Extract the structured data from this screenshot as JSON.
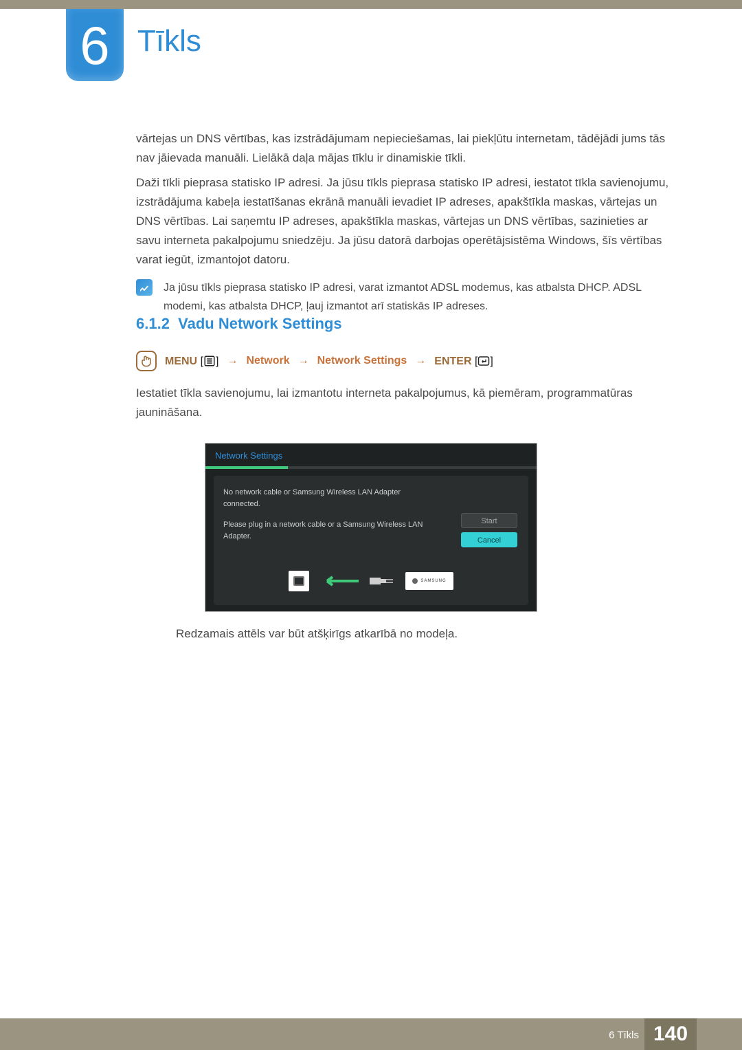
{
  "chapter": {
    "number": "6",
    "title": "Tīkls"
  },
  "para1": "vārtejas un DNS vērtības, kas izstrādājumam nepieciešamas, lai piekļūtu internetam, tādējādi jums tās nav jāievada manuāli. Lielākā daļa mājas tīklu ir dinamiskie tīkli.",
  "para2": "Daži tīkli pieprasa statisko IP adresi. Ja jūsu tīkls pieprasa statisko IP adresi, iestatot tīkla savienojumu, izstrādājuma kabeļa iestatīšanas ekrānā manuāli ievadiet IP adreses, apakštīkla maskas, vārtejas un DNS vērtības. Lai saņemtu IP adreses, apakštīkla maskas, vārtejas un DNS vērtības, sazinieties ar savu interneta pakalpojumu sniedzēju. Ja jūsu datorā darbojas operētājsistēma Windows, šīs vērtības varat iegūt, izmantojot datoru.",
  "note": "Ja jūsu tīkls pieprasa statisko IP adresi, varat izmantot ADSL modemus, kas atbalsta DHCP. ADSL modemi, kas atbalsta DHCP, ļauj izmantot arī statiskās IP adreses.",
  "section": {
    "number": "6.1.2",
    "title": "Vadu Network Settings"
  },
  "nav": {
    "menu": "MENU",
    "arrow": "→",
    "network": "Network",
    "network_settings": "Network Settings",
    "enter": "ENTER"
  },
  "body3": "Iestatiet tīkla savienojumu, lai izmantotu interneta pakalpojumus, kā piemēram, programmatūras jaunināšana.",
  "ns": {
    "title": "Network Settings",
    "msg1": "No network cable or Samsung Wireless LAN Adapter connected.",
    "msg2": "Please plug in a network cable or a Samsung Wireless LAN Adapter.",
    "start": "Start",
    "cancel": "Cancel",
    "brand": "SAMSUNG"
  },
  "caption": "Redzamais attēls var būt atšķirīgs atkarībā no modeļa.",
  "footer": {
    "label": "6 Tīkls",
    "page": "140"
  }
}
